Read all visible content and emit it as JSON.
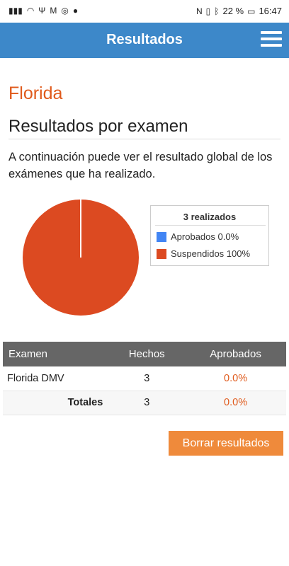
{
  "status_bar": {
    "left_icons": [
      "signal-icon",
      "wifi-icon",
      "usb-icon",
      "gmail-icon",
      "whatsapp-icon",
      "chat-icon"
    ],
    "right_icons": [
      "nfc-icon",
      "vibrate-icon",
      "bluetooth-icon"
    ],
    "battery": "22 %",
    "time": "16:47"
  },
  "app_bar": {
    "title": "Resultados",
    "menu_icon": "hamburger-menu-icon"
  },
  "page": {
    "state": "Florida",
    "section_title": "Resultados por examen",
    "description": "A continuación puede ver el resultado global de los exámenes que ha realizado."
  },
  "chart_data": {
    "type": "pie",
    "title": "3 realizados",
    "legend_position": "right",
    "series": [
      {
        "name": "Aprobados 0.0%",
        "value": 0,
        "color": "#4285f4"
      },
      {
        "name": "Suspendidos 100%",
        "value": 100,
        "color": "#dc4a21"
      }
    ]
  },
  "table": {
    "headers": [
      "Examen",
      "Hechos",
      "Aprobados"
    ],
    "rows": [
      {
        "exam": "Florida DMV",
        "done": "3",
        "passed": "0.0%"
      }
    ],
    "totals": {
      "label": "Totales",
      "done": "3",
      "passed": "0.0%"
    }
  },
  "button": {
    "label": "Borrar resultados",
    "color": "#ef8a3b"
  },
  "colors": {
    "accent": "#e05a1c",
    "appbar": "#3d88c9"
  }
}
